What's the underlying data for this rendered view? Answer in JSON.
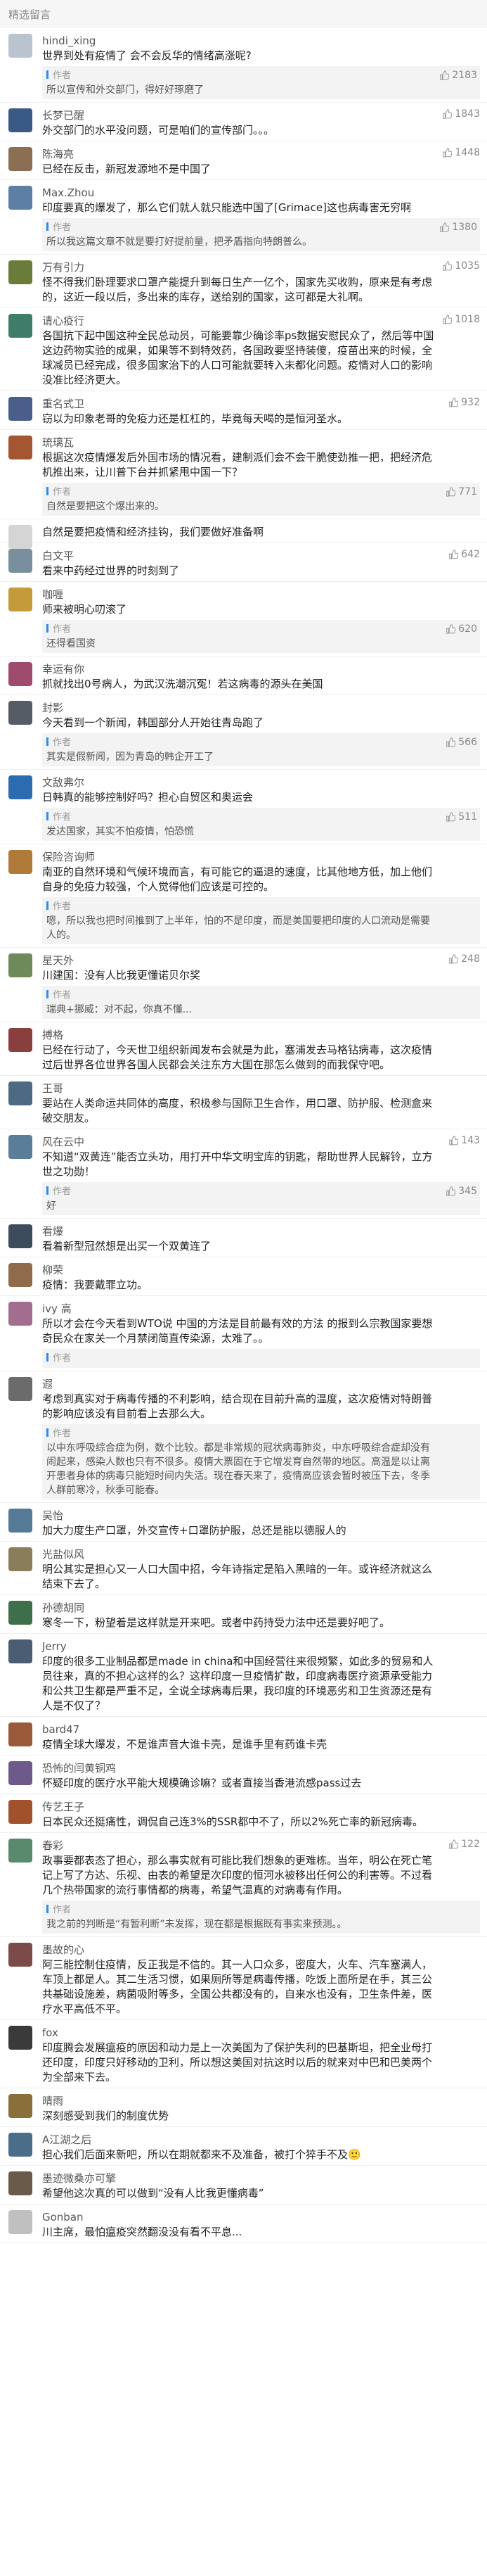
{
  "header": {
    "title": "精选留言"
  },
  "author_label": "作者",
  "comments": [
    {
      "name": "hindi_xing",
      "likes": "",
      "text": "世界到处有疫情了 会不会反华的情绪高涨呢?",
      "reply": {
        "text": "所以宣传和外交部门，得好好琢磨了",
        "likes": "2183"
      },
      "avatar_color": "#b9c4cf"
    },
    {
      "name": "长梦已醒",
      "likes": "1843",
      "text": "外交部门的水平没问题，可是咱们的宣传部门。。。",
      "reply": null,
      "avatar_color": "#3a5a86"
    },
    {
      "name": "陈海亮",
      "likes": "1448",
      "text": "已经在反击，新冠发源地不是中国了",
      "reply": null,
      "avatar_color": "#8b6f52"
    },
    {
      "name": "Max.Zhou",
      "likes": "",
      "text": "印度要真的爆发了，那么它们就人就只能选中国了[Grimace]这也病毒害无穷啊",
      "reply": {
        "text": "所以我这篇文章不就是要打好提前量，把矛盾指向特朗普么。",
        "likes": "1380"
      },
      "avatar_color": "#5d7fa6"
    },
    {
      "name": "万有引力",
      "likes": "1035",
      "text": "怪不得我们卧理要求口罩产能提升到每日生产一亿个，国家先买收购，原来是有考虑的，这近一段以后，多出来的库存，送给别的国家，这可都是大礼啊。",
      "reply": null,
      "avatar_color": "#6a7b3a"
    },
    {
      "name": "请心疫行",
      "likes": "1018",
      "text": "各国抗下起中国这种全民总动员，可能要靠少确诊率ps数据安慰民众了，然后等中国这边药物实验的成果，如果等不到特效药，各国政要坚持装傻，疫苗出来的时候，全球减员已经完成，很多国家治下的人口可能就要转入未都化问题。疫情对人口的影响没准比经济更大。",
      "reply": null,
      "avatar_color": "#3f7d6a"
    },
    {
      "name": "重名式卫",
      "likes": "932",
      "text": "窃以为印象老哥的免疫力还是杠杠的，毕竟每天喝的是恒河圣水。",
      "reply": null,
      "avatar_color": "#4b5d8a"
    },
    {
      "name": "琉璃瓦",
      "likes": "",
      "text": "根据这次疫情爆发后外国市场的情况看，建制派们会不会干脆使劲推一把，把经济危机推出来，让川普下台并抓紧甩中国一下？",
      "reply": {
        "text": "自然是要把这个爆出来的。",
        "likes": "771"
      },
      "avatar_color": "#a3562f"
    },
    {
      "name": "",
      "likes": "",
      "text": "自然是要把疫情和经济挂钩，我们要做好准备啊",
      "reply": null,
      "avatar_color": "#d5d5d5"
    },
    {
      "name": "白文平",
      "likes": "642",
      "text": "看来中药经过世界的时刻到了",
      "reply": null,
      "avatar_color": "#7a8f9e"
    },
    {
      "name": "咖喱",
      "likes": "",
      "text": "师来被明心叨滚了",
      "reply": {
        "text": "还得看国资",
        "likes": "620"
      },
      "avatar_color": "#c49a3b"
    },
    {
      "name": "幸运有你",
      "likes": "",
      "text": "抓就找出0号病人，为武汉洗潮沉冤！若这病毒的源头在美国",
      "reply": null,
      "avatar_color": "#9e4c6e"
    },
    {
      "name": "封影",
      "likes": "",
      "text": "今天看到一个新闻，韩国部分人开始往青岛跑了",
      "reply": {
        "text": "其实是假新闻，因为青岛的韩企开工了",
        "likes": "566"
      },
      "avatar_color": "#555c66"
    },
    {
      "name": "文敌弗尔",
      "likes": "",
      "text": "日韩真的能够控制好吗？担心自贸区和奥运会",
      "reply": {
        "text": "发达国家，其实不怕疫情，怕恐慌",
        "likes": "511"
      },
      "avatar_color": "#2b6cb0"
    },
    {
      "name": "保险咨询师",
      "likes": "",
      "text": "南亚的自然环境和气候环境而言，有可能它的逼退的速度，比其他地方低，加上他们自身的免疫力较强，个人觉得他们应该是可控的。",
      "reply": {
        "text": "嗯，所以我也把时间推到了上半年，怕的不是印度，而是美国要把印度的人口流动是需要人的。",
        "likes": ""
      },
      "avatar_color": "#b07a3a"
    },
    {
      "name": "星天外",
      "likes": "248",
      "text": "川建国：没有人比我更懂诺贝尔奖",
      "reply": {
        "text": "瑞典+挪威：对不起，你真不懂...",
        "likes": ""
      },
      "avatar_color": "#6f8a5a"
    },
    {
      "name": "搏格",
      "likes": "",
      "text": "已经在行动了，今天世卫组织新闻发布会就是为此，塞浦发去马格钻病毒，这次疫情过后世界各位世界各国人民都会关注东方大国在那怎么做到的而我保守吧。",
      "reply": null,
      "avatar_color": "#8a3f3f"
    },
    {
      "name": "王哥",
      "likes": "",
      "text": "要站在人类命运共同体的高度，积极参与国际卫生合作，用口罩、防护服、检测盒来破交朋友。",
      "reply": null,
      "avatar_color": "#4d6a82"
    },
    {
      "name": "风在云中",
      "likes": "143",
      "text": "不知道“双黄连”能否立头功，用打开中华文明宝库的钥匙，帮助世界人民解铃，立方世之功勋！",
      "reply": {
        "text": "好",
        "likes": "345"
      },
      "avatar_color": "#5a7d9a"
    },
    {
      "name": "看爆",
      "likes": "",
      "text": "看着新型冠然想是出买一个双黄连了",
      "reply": null,
      "avatar_color": "#3c4c5c"
    },
    {
      "name": "柳荣",
      "likes": "",
      "text": "疫情：我要戴罪立功。",
      "reply": null,
      "avatar_color": "#8f6b4a"
    },
    {
      "name": "ivy 高",
      "likes": "",
      "text": "所以才会在今天看到WTO说 中国的方法是目前最有效的方法 的报到么宗教国家要想奇民众在家关一个月禁闭简直传染源，太难了。。",
      "reply": {
        "text": "",
        "likes": ""
      },
      "avatar_color": "#a36d8f"
    },
    {
      "name": "遐",
      "likes": "",
      "text": "考虑到真实对于病毒传播的不利影响，结合现在目前升高的温度，这次疫情对特朗普的影响应该没有目前看上去那么大。",
      "reply": {
        "text": "以中东呼吸综合症为例，数个比较。都是非常规的冠状病毒肺炎，中东呼吸综合症却没有闹起来，感染人数也只有不很多。疫情大票固在于它增发育自然带的地区。高温是以让离开患者身体的病毒只能短时间内失活。现在春天来了，疫情高应该会暂时被压下去，冬季人群前寒冷，秋季可能春。",
        "likes": ""
      },
      "avatar_color": "#6b6b6b"
    },
    {
      "name": "吴怡",
      "likes": "",
      "text": "加大力度生产口罩，外交宣传+口罩防护服，总还是能以德服人的",
      "reply": null,
      "avatar_color": "#557a95"
    },
    {
      "name": "光盐似风",
      "likes": "",
      "text": "明公其实是担心又一人口大国中招，今年诗指定是陷入黑暗的一年。或许经济就这么结束下去了。",
      "reply": null,
      "avatar_color": "#8a7d5a"
    },
    {
      "name": "孙德胡同",
      "likes": "",
      "text": "寒冬一下，粉望着是这样就是开来吧。或者中药持受力法中还是要好吧了。",
      "reply": null,
      "avatar_color": "#3f6e4a"
    },
    {
      "name": "Jerry",
      "likes": "",
      "text": "印度的很多工业制品都是made in china和中国经营往来很频繁，如此多的贸易和人员往来，真的不担心这样的么？这样印度一旦疫情扩散，印度病毒医疗资源承受能力和公共卫生都是严重不足，全说全球病毒后果，我印度的环境恶劣和卫生资源还是有人是不仅了？",
      "reply": null,
      "avatar_color": "#4a5d72"
    },
    {
      "name": "bard47",
      "likes": "",
      "text": "疫情全球大爆发，不是谁声音大谁卡壳，是谁手里有药谁卡壳",
      "reply": null,
      "avatar_color": "#9a5a3a"
    },
    {
      "name": "恐怖的闫黄铜鸡",
      "likes": "",
      "text": "怀疑印度的医疗水平能大规模确诊嘛？或者直接当香港流感pass过去",
      "reply": null,
      "avatar_color": "#6e5a8a"
    },
    {
      "name": "传艺王子",
      "likes": "",
      "text": "日本民众还挺痛性，调侃自己连3%的SSR都中不了，所以2%死亡率的新冠病毒。",
      "reply": null,
      "avatar_color": "#a0522d"
    },
    {
      "name": "春彩",
      "likes": "122",
      "text": "政事要都表态了担心，那么事实就有可能比我们想象的更难栋。当年，明公在死亡笔记上写了方达、乐视、由表的希望是次印度的恒河水被移出任何公的利害等。不过看几个热带国家的流行事情都的病毒，希望气温真的对病毒有作用。",
      "reply": {
        "text": "我之前的判断是“有暂利断”未发挥，现在都是根据既有事实来预测。。",
        "likes": ""
      },
      "avatar_color": "#5a8a6e"
    },
    {
      "name": "墨故的心",
      "likes": "",
      "text": "阿三能控制住疫情，反正我是不信的。其一人口众多，密度大，火车、汽车塞满人，车顶上都是人。其二生活习惯，如果厕所等是病毒传播，吃饭上面所是在手，其三公共基础设施差，病菌吸附等多，全国公共都没有的，自来水也没有，卫生条件差，医疗水平高低不平。",
      "reply": null,
      "avatar_color": "#7d4a4a"
    },
    {
      "name": "fox",
      "likes": "",
      "text": "印度腾会发展瘟疫的原因和动力是上一次美国为了保护失利的巴基斯坦，把全业母打还印度，印度只好移动的卫利，所以想这美国对抗这时以后的就来对中巴和巴美两个为全部来下去。",
      "reply": null,
      "avatar_color": "#3a3a3a"
    },
    {
      "name": "晴雨",
      "likes": "",
      "text": "深刻感受到我们的制度优势",
      "reply": null,
      "avatar_color": "#8a6f3a"
    },
    {
      "name": "A江湖之后",
      "likes": "",
      "text": "担心我们后面来新吧，所以在期就都来不及准备，被打个猝手不及🙂",
      "reply": null,
      "avatar_color": "#4a6e8a"
    },
    {
      "name": "墨迹微桑亦可擎",
      "likes": "",
      "text": "希望他这次真的可以做到“没有人比我更懂病毒”",
      "reply": null,
      "avatar_color": "#6a5a4a"
    },
    {
      "name": "Gonban",
      "likes": "",
      "text": "川主席，最怕瘟疫突然翻没没有看不平息...",
      "reply": null,
      "avatar_color": "#c0c0c0"
    }
  ]
}
